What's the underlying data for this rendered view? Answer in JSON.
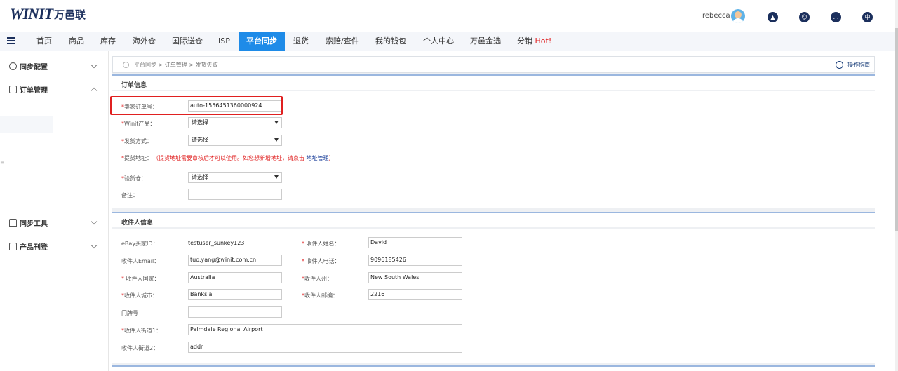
{
  "header": {
    "logo_text": "WINIT",
    "logo_cn": "万邑联",
    "username": "rebecca",
    "lang_label": "中"
  },
  "nav": {
    "items": [
      "首页",
      "商品",
      "库存",
      "海外仓",
      "国际送仓",
      "ISP",
      "平台同步",
      "退货",
      "索赔/查件",
      "我的钱包",
      "个人中心",
      "万邑金选",
      "分销"
    ],
    "active": "平台同步",
    "hot_label": "Hot!"
  },
  "sidebar": {
    "items": [
      "同步配置",
      "订单管理",
      "同步工具",
      "产品刊登"
    ],
    "dot": "≡"
  },
  "breadcrumb": {
    "path": "平台同步 > 订单管理 > 发货失败",
    "guide": "操作指南"
  },
  "order_info": {
    "title": "订单信息",
    "seller_order_label": "卖家订单号：",
    "seller_order_value": "auto-1556451360000924",
    "product_label": "Winit产品：",
    "product_value": "请选择",
    "ship_method_label": "发货方式：",
    "ship_method_value": "请选择",
    "pickup_label": "提货地址：",
    "pickup_hint": "（提货地址需要审核后才可以使用。如您想新增地址，请点击",
    "pickup_link": "地址管理",
    "pickup_hint_end": "）",
    "inspect_label": "验货仓：",
    "inspect_value": "请选择",
    "remark_label": "备注：",
    "remark_value": ""
  },
  "receiver_info": {
    "title": "收件人信息",
    "ebay_id_label": "eBay买家ID：",
    "ebay_id_value": "testuser_sunkey123",
    "name_label": "收件人姓名：",
    "name_value": "David",
    "email_label": "收件人Email：",
    "email_value": "tuo.yang@winit.com.cn",
    "phone_label": "收件人电话：",
    "phone_value": "9096185426",
    "country_label": "收件人国家：",
    "country_value": "Australia",
    "state_label": "收件人州：",
    "state_value": "New South Wales",
    "city_label": "收件人城市：",
    "city_value": "Banksia",
    "zip_label": "收件人邮编：",
    "zip_value": "2216",
    "door_label": "门牌号",
    "door_value": "",
    "street1_label": "收件人街道1：",
    "street1_value": "Palmdale Regional Airport",
    "street2_label": "收件人街道2：",
    "street2_value": "addr"
  }
}
